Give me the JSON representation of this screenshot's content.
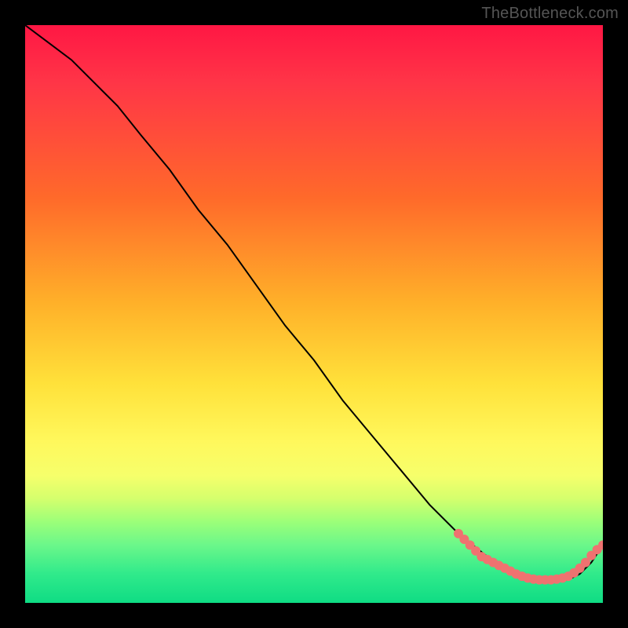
{
  "watermark": "TheBottleneck.com",
  "colors": {
    "background": "#000000",
    "point": "#ef7270",
    "curve": "#000000"
  },
  "chart_data": {
    "type": "line",
    "title": "",
    "xlabel": "",
    "ylabel": "",
    "xlim": [
      0,
      100
    ],
    "ylim": [
      0,
      100
    ],
    "grid": false,
    "legend": false,
    "series": [
      {
        "name": "curve",
        "x": [
          0,
          4,
          8,
          12,
          16,
          20,
          25,
          30,
          35,
          40,
          45,
          50,
          55,
          60,
          65,
          70,
          75,
          80,
          85,
          88,
          90,
          92,
          94,
          96,
          98,
          100
        ],
        "y": [
          100,
          97,
          94,
          90,
          86,
          81,
          75,
          68,
          62,
          55,
          48,
          42,
          35,
          29,
          23,
          17,
          12,
          8,
          5,
          4,
          4,
          4,
          4,
          5,
          7,
          10
        ]
      }
    ],
    "points": [
      {
        "x": 75,
        "y": 12
      },
      {
        "x": 76,
        "y": 11
      },
      {
        "x": 77,
        "y": 10
      },
      {
        "x": 78,
        "y": 9
      },
      {
        "x": 79,
        "y": 8
      },
      {
        "x": 80,
        "y": 7.5
      },
      {
        "x": 81,
        "y": 7
      },
      {
        "x": 82,
        "y": 6.5
      },
      {
        "x": 83,
        "y": 6
      },
      {
        "x": 84,
        "y": 5.5
      },
      {
        "x": 85,
        "y": 5
      },
      {
        "x": 86,
        "y": 4.6
      },
      {
        "x": 87,
        "y": 4.3
      },
      {
        "x": 88,
        "y": 4.1
      },
      {
        "x": 89,
        "y": 4
      },
      {
        "x": 90,
        "y": 4
      },
      {
        "x": 91,
        "y": 4
      },
      {
        "x": 92,
        "y": 4.1
      },
      {
        "x": 93,
        "y": 4.3
      },
      {
        "x": 94,
        "y": 4.6
      },
      {
        "x": 95,
        "y": 5.2
      },
      {
        "x": 96,
        "y": 6
      },
      {
        "x": 97,
        "y": 7
      },
      {
        "x": 98,
        "y": 8.2
      },
      {
        "x": 99,
        "y": 9.2
      },
      {
        "x": 100,
        "y": 10
      }
    ]
  }
}
